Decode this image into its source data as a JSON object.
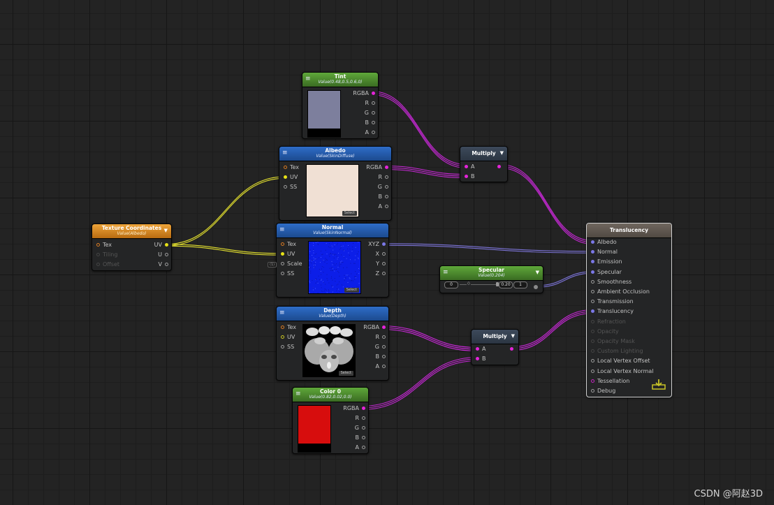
{
  "nodes": {
    "tint": {
      "title": "Tint",
      "subtitle": "Value(0.48,0.5,0.6,0)",
      "swatch_color": "#7d7f9d",
      "outputs": [
        "RGBA",
        "R",
        "G",
        "B",
        "A"
      ]
    },
    "albedo": {
      "title": "Albedo",
      "subtitle": "Value(SkinDiffuse)",
      "swatch_color": "#f0e0d4",
      "inputs": [
        "Tex",
        "UV",
        "SS"
      ],
      "outputs": [
        "RGBA",
        "R",
        "G",
        "B",
        "A"
      ],
      "select_label": "Select"
    },
    "texture_coordinates": {
      "title": "Texture Coordinates",
      "subtitle": "Value(Albedo)",
      "inputs": [
        "Tex",
        "Tiling",
        "Offset"
      ],
      "outputs": [
        "UV",
        "U",
        "V"
      ]
    },
    "normal": {
      "title": "Normal",
      "subtitle": "Value(SkinNormal)",
      "swatch_color": "#0c1ee8",
      "inputs": [
        "Tex",
        "UV",
        "Scale",
        "SS"
      ],
      "outputs": [
        "XYZ",
        "X",
        "Y",
        "Z"
      ],
      "select_label": "Select",
      "scale_value": "(1)"
    },
    "depth": {
      "title": "Depth",
      "subtitle": "Value(Depth)",
      "inputs": [
        "Tex",
        "UV",
        "SS"
      ],
      "outputs": [
        "RGBA",
        "R",
        "G",
        "B",
        "A"
      ],
      "select_label": "Select"
    },
    "color0": {
      "title": "Color 0",
      "subtitle": "Value(0.82,0.02,0.0)",
      "swatch_color": "#d70d0d",
      "outputs": [
        "RGBA",
        "R",
        "G",
        "B",
        "A"
      ]
    },
    "multiply_top": {
      "title": "Multiply",
      "inputs": [
        "A",
        "B"
      ]
    },
    "multiply_bottom": {
      "title": "Multiply",
      "inputs": [
        "A",
        "B"
      ]
    },
    "specular": {
      "title": "Specular",
      "subtitle": "Value(0.204)",
      "min": "0",
      "max": "1",
      "mid": "0",
      "value": "0.20"
    },
    "translucency": {
      "title": "Translucency",
      "inputs": [
        {
          "label": "Albedo",
          "state": "vec"
        },
        {
          "label": "Normal",
          "state": "vec"
        },
        {
          "label": "Emission",
          "state": "vec"
        },
        {
          "label": "Specular",
          "state": "vec"
        },
        {
          "label": "Smoothness",
          "state": "hollow"
        },
        {
          "label": "Ambient Occlusion",
          "state": "hollow"
        },
        {
          "label": "Transmission",
          "state": "hollow"
        },
        {
          "label": "Translucency",
          "state": "vec"
        },
        {
          "label": "Refraction",
          "state": "dim"
        },
        {
          "label": "Opacity",
          "state": "dim"
        },
        {
          "label": "Opacity Mask",
          "state": "dim"
        },
        {
          "label": "Custom Lighting",
          "state": "dim"
        },
        {
          "label": "Local Vertex Offset",
          "state": "hollow"
        },
        {
          "label": "Local Vertex Normal",
          "state": "hollow"
        },
        {
          "label": "Tessellation",
          "state": "mag"
        },
        {
          "label": "Debug",
          "state": "hollow"
        }
      ]
    }
  },
  "watermark": "CSDN @阿赵3D",
  "colors": {
    "rgba_wire": "#c728d6",
    "uv_wire": "#e2df2e",
    "vector_wire": "#7b73d6"
  }
}
